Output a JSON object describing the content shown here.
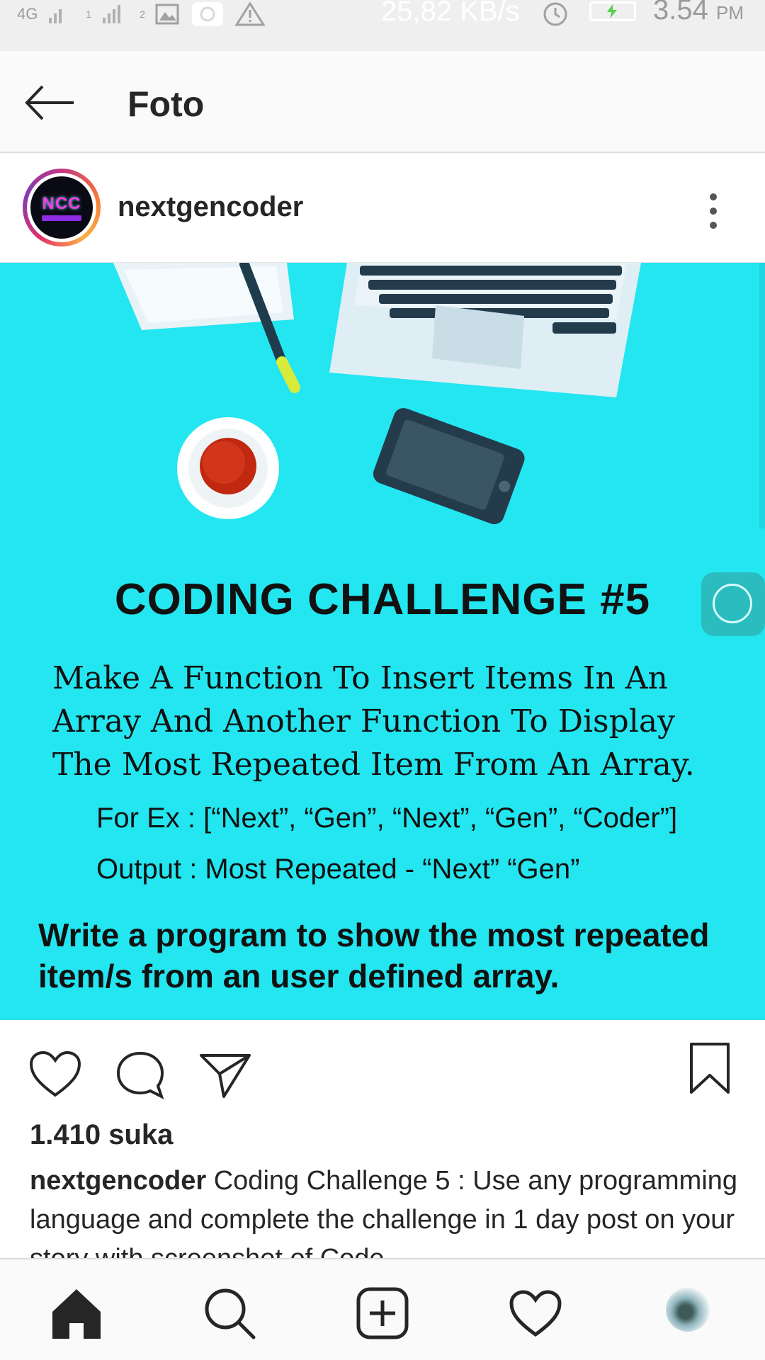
{
  "status_bar": {
    "network": "4G",
    "signal_1_label": "1",
    "signal_2_label": "2",
    "net_speed": "25,82 KB/s",
    "time": "3.54",
    "ampm": "PM",
    "icons": [
      "signal-icon",
      "gallery-icon",
      "camera-icon",
      "warning-icon",
      "alarm-icon",
      "battery-charging-icon"
    ]
  },
  "app_bar": {
    "title": "Foto",
    "back_icon": "arrow-left-icon"
  },
  "post": {
    "username": "nextgencoder",
    "avatar_text": "NCC",
    "more_icon": "vertical-dots-icon",
    "image": {
      "heading": "CODING CHALLENGE #5",
      "task": "Make A Function To Insert Items In An Array And Another Function To Display The Most Repeated Item From An Array.",
      "example": "For Ex : [“Next”, “Gen”, “Next”, “Gen”, “Coder”]",
      "output": "Output : Most Repeated - “Next” “Gen”",
      "prompt": "Write a program to show the most repeated item/s from an user defined array.",
      "background_color": "#23e6f0"
    },
    "actions": [
      "heart-icon",
      "comment-icon",
      "share-icon",
      "bookmark-icon"
    ],
    "likes": "1.410 suka",
    "caption_user": "nextgencoder",
    "caption_text": "Coding Challenge 5 : Use any programming language and complete the challenge in 1 day post on your story with screenshot of Code"
  },
  "bottom_nav": {
    "items": [
      "home-icon",
      "search-icon",
      "add-post-icon",
      "activity-heart-icon",
      "profile-avatar"
    ]
  },
  "colors": {
    "text": "#262626",
    "accent_cyan": "#23e6f0",
    "status_bar_bg": "#efefef"
  }
}
